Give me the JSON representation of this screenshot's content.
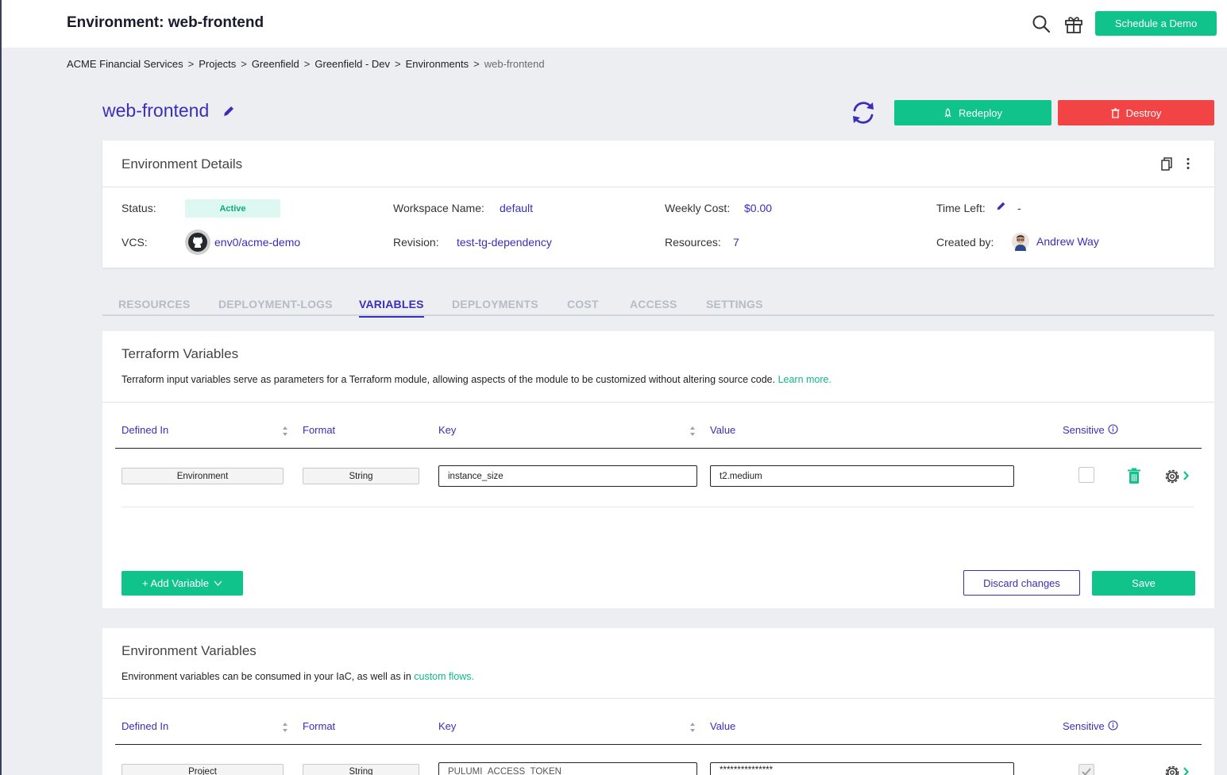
{
  "header": {
    "title": "Environment: web-frontend",
    "schedule_demo_label": "Schedule a Demo",
    "accent": "#10c38b"
  },
  "breadcrumb": {
    "items": [
      "ACME Financial Services",
      "Projects",
      "Greenfield",
      "Greenfield - Dev",
      "Environments"
    ],
    "current": "web-frontend",
    "separator": ">"
  },
  "environment": {
    "name": "web-frontend",
    "redeploy_label": "Redeploy",
    "destroy_label": "Destroy"
  },
  "details": {
    "title": "Environment Details",
    "status_label": "Status:",
    "status_value": "Active",
    "workspace_label": "Workspace Name:",
    "workspace_value": "default",
    "weekly_cost_label": "Weekly Cost:",
    "weekly_cost_value": "$0.00",
    "time_left_label": "Time Left:",
    "time_left_value": "-",
    "vcs_label": "VCS:",
    "vcs_value": "env0/acme-demo",
    "revision_label": "Revision:",
    "revision_value": "test-tg-dependency",
    "resources_label": "Resources:",
    "resources_value": "7",
    "created_by_label": "Created by:",
    "created_by_value": "Andrew Way"
  },
  "tabs": [
    "RESOURCES",
    "DEPLOYMENT-LOGS",
    "VARIABLES",
    "DEPLOYMENTS",
    "COST",
    "ACCESS",
    "SETTINGS"
  ],
  "active_tab": "VARIABLES",
  "terraform_vars": {
    "title": "Terraform Variables",
    "description": "Terraform input variables serve as parameters for a Terraform module, allowing aspects of the module to be customized without altering source code.",
    "learn_more": "Learn more.",
    "columns": {
      "defined_in": "Defined In",
      "format": "Format",
      "key": "Key",
      "value": "Value",
      "sensitive": "Sensitive"
    },
    "rows": [
      {
        "defined_in": "Environment",
        "format": "String",
        "key": "instance_size",
        "value": "t2.medium",
        "sensitive": false
      }
    ],
    "add_variable_label": "+ Add Variable",
    "discard_label": "Discard changes",
    "save_label": "Save"
  },
  "env_vars": {
    "title": "Environment Variables",
    "description": "Environment variables can be consumed in your IaC, as well as in",
    "custom_flows": "custom flows.",
    "columns": {
      "defined_in": "Defined In",
      "format": "Format",
      "key": "Key",
      "value": "Value",
      "sensitive": "Sensitive"
    },
    "rows": [
      {
        "defined_in": "Project",
        "format": "String",
        "key": "PULUMI_ACCESS_TOKEN",
        "value": "***************",
        "sensitive": true
      }
    ]
  }
}
